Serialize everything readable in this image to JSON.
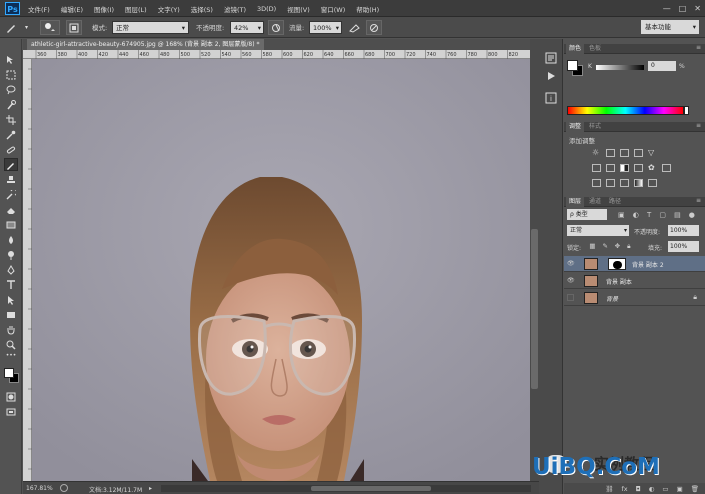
{
  "menubar": {
    "logo": "Ps",
    "items": [
      "文件(F)",
      "编辑(E)",
      "图像(I)",
      "图层(L)",
      "文字(Y)",
      "选择(S)",
      "滤镜(T)",
      "3D(D)",
      "视图(V)",
      "窗口(W)",
      "帮助(H)"
    ],
    "window_controls": [
      "—",
      "□",
      "✕"
    ]
  },
  "options": {
    "mode_label": "模式:",
    "mode_value": "正常",
    "opacity_label": "不透明度:",
    "opacity_value": "42%",
    "flow_label": "流量:",
    "flow_value": "100%",
    "workspace": "基本功能"
  },
  "document": {
    "tab_title": "athletic-girl-attractive-beauty-674905.jpg @ 168% (背景 副本 2, 图层蒙版/8) *",
    "zoom": "167.81%",
    "doc_info": "文档:3.12M/11.7M",
    "ruler_marks": [
      "360",
      "380",
      "400",
      "420",
      "440",
      "460",
      "480",
      "500",
      "520",
      "540",
      "560",
      "580",
      "600",
      "620",
      "640",
      "660",
      "680",
      "700",
      "720",
      "740",
      "760",
      "780",
      "800",
      "820"
    ]
  },
  "color_panel": {
    "tabs": [
      "颜色",
      "色板"
    ],
    "k_label": "K",
    "k_value": "0",
    "k_unit": "%"
  },
  "adjustments_panel": {
    "tabs": [
      "调整",
      "样式"
    ],
    "title": "添加调整"
  },
  "layers_panel": {
    "tabs": [
      "图层",
      "通道",
      "路径"
    ],
    "filter_label": "ρ 类型",
    "blend_mode": "正常",
    "opacity_label": "不透明度:",
    "opacity_value": "100%",
    "lock_label": "锁定:",
    "fill_label": "填充:",
    "fill_value": "100%",
    "layers": [
      {
        "name": "背景 副本 2",
        "visible": true,
        "selected": true,
        "has_mask": true
      },
      {
        "name": "背景 副本",
        "visible": true,
        "selected": false,
        "has_mask": false
      },
      {
        "name": "背景",
        "visible": false,
        "selected": false,
        "has_mask": false,
        "locked": true
      }
    ]
  },
  "watermark": {
    "text": "UiBQ.CoM",
    "subtext": "实例教程"
  },
  "colors": {
    "bg": "#535353",
    "menubar": "#3c3c3c",
    "selected_layer": "#5f6f86",
    "canvas_bg": "#9c9aa5",
    "watermark": "#1e6fb8"
  }
}
